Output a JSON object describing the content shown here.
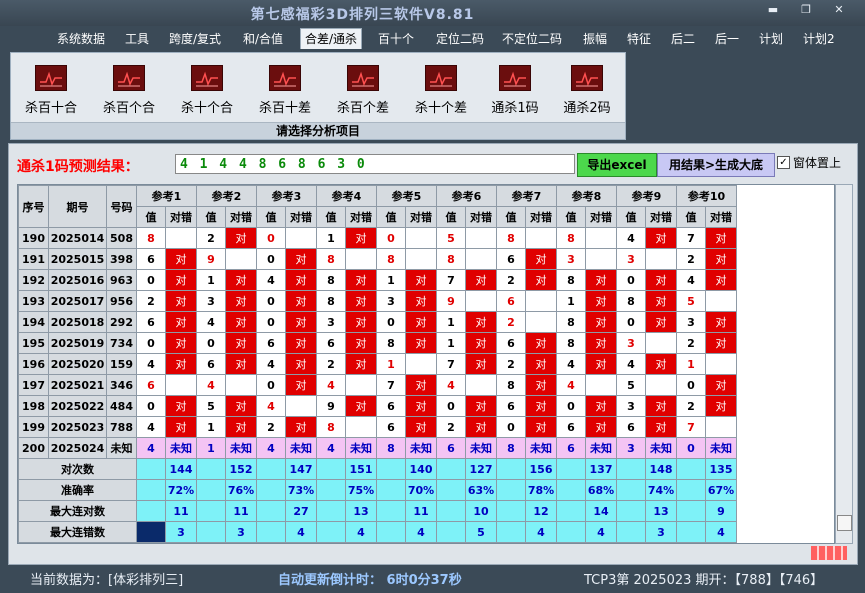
{
  "window": {
    "title": "第七感福彩3D排列三软件V8.81"
  },
  "menu": [
    "系统数据",
    "工具",
    "跨度/复式",
    "和/合值",
    "合差/通杀",
    "百十个",
    "定位二码",
    "不定位二码",
    "振幅",
    "特征",
    "后二",
    "后一",
    "计划",
    "计划2"
  ],
  "menu_active_index": 4,
  "ribbon": {
    "buttons": [
      "杀百十合",
      "杀百个合",
      "杀十个合",
      "杀百十差",
      "杀百个差",
      "杀十个差",
      "通杀1码",
      "通杀2码"
    ],
    "footer": "请选择分析项目"
  },
  "prediction": {
    "label": "通杀1码预测结果：",
    "value": "4 1 4 4 8 6 8 6 3 0",
    "excel_button": "导出excel",
    "generate_button": "用结果>生成大底",
    "topmost_label": "窗体置上",
    "topmost_checked": "✓"
  },
  "table": {
    "headers": {
      "seq": "序号",
      "period": "期号",
      "number": "号码",
      "refs": [
        "参考1",
        "参考2",
        "参考3",
        "参考4",
        "参考5",
        "参考6",
        "参考7",
        "参考8",
        "参考9",
        "参考10"
      ],
      "sub_value": "值",
      "sub_result": "对错"
    },
    "hit_text": "对",
    "rows": [
      {
        "seq": "190",
        "period": "2025014",
        "num": "508",
        "vals": [
          "8",
          "2",
          "0",
          "1",
          "0",
          "5",
          "8",
          "8",
          "4",
          "7"
        ],
        "hits": [
          0,
          1,
          0,
          1,
          0,
          0,
          0,
          0,
          1,
          1
        ],
        "red": [
          1,
          0,
          1,
          0,
          1,
          1,
          1,
          1,
          0,
          0
        ]
      },
      {
        "seq": "191",
        "period": "2025015",
        "num": "398",
        "vals": [
          "6",
          "9",
          "0",
          "8",
          "8",
          "8",
          "6",
          "3",
          "3",
          "2"
        ],
        "hits": [
          1,
          0,
          1,
          0,
          0,
          0,
          1,
          0,
          0,
          1
        ],
        "red": [
          0,
          1,
          0,
          1,
          1,
          1,
          0,
          1,
          1,
          0
        ]
      },
      {
        "seq": "192",
        "period": "2025016",
        "num": "963",
        "vals": [
          "0",
          "1",
          "4",
          "8",
          "1",
          "7",
          "2",
          "8",
          "0",
          "4"
        ],
        "hits": [
          1,
          1,
          1,
          1,
          1,
          1,
          1,
          1,
          1,
          1
        ],
        "red": [
          0,
          0,
          0,
          0,
          0,
          0,
          0,
          0,
          0,
          0
        ]
      },
      {
        "seq": "193",
        "period": "2025017",
        "num": "956",
        "vals": [
          "2",
          "3",
          "0",
          "8",
          "3",
          "9",
          "6",
          "1",
          "8",
          "5"
        ],
        "hits": [
          1,
          1,
          1,
          1,
          1,
          0,
          0,
          1,
          1,
          0
        ],
        "red": [
          0,
          0,
          0,
          0,
          0,
          1,
          1,
          0,
          0,
          1
        ]
      },
      {
        "seq": "194",
        "period": "2025018",
        "num": "292",
        "vals": [
          "6",
          "4",
          "0",
          "3",
          "0",
          "1",
          "2",
          "8",
          "0",
          "3"
        ],
        "hits": [
          1,
          1,
          1,
          1,
          1,
          1,
          0,
          1,
          1,
          1
        ],
        "red": [
          0,
          0,
          0,
          0,
          0,
          0,
          1,
          0,
          0,
          0
        ]
      },
      {
        "seq": "195",
        "period": "2025019",
        "num": "734",
        "vals": [
          "0",
          "0",
          "6",
          "6",
          "8",
          "1",
          "6",
          "8",
          "3",
          "2"
        ],
        "hits": [
          1,
          1,
          1,
          1,
          1,
          1,
          1,
          1,
          0,
          1
        ],
        "red": [
          0,
          0,
          0,
          0,
          0,
          0,
          0,
          0,
          1,
          0
        ]
      },
      {
        "seq": "196",
        "period": "2025020",
        "num": "159",
        "vals": [
          "4",
          "6",
          "4",
          "2",
          "1",
          "7",
          "2",
          "4",
          "4",
          "1"
        ],
        "hits": [
          1,
          1,
          1,
          1,
          0,
          1,
          1,
          1,
          1,
          0
        ],
        "red": [
          0,
          0,
          0,
          0,
          1,
          0,
          0,
          0,
          0,
          1
        ]
      },
      {
        "seq": "197",
        "period": "2025021",
        "num": "346",
        "vals": [
          "6",
          "4",
          "0",
          "4",
          "7",
          "4",
          "8",
          "4",
          "5",
          "0"
        ],
        "hits": [
          0,
          0,
          1,
          0,
          1,
          0,
          1,
          0,
          0,
          1
        ],
        "red": [
          1,
          1,
          0,
          1,
          0,
          1,
          0,
          1,
          0,
          0
        ]
      },
      {
        "seq": "198",
        "period": "2025022",
        "num": "484",
        "vals": [
          "0",
          "5",
          "4",
          "9",
          "6",
          "0",
          "6",
          "0",
          "3",
          "2"
        ],
        "hits": [
          1,
          1,
          0,
          1,
          1,
          1,
          1,
          1,
          1,
          1
        ],
        "red": [
          0,
          0,
          1,
          0,
          0,
          0,
          0,
          0,
          0,
          0
        ]
      },
      {
        "seq": "199",
        "period": "2025023",
        "num": "788",
        "vals": [
          "4",
          "1",
          "2",
          "8",
          "6",
          "2",
          "0",
          "6",
          "6",
          "7"
        ],
        "hits": [
          1,
          1,
          1,
          0,
          1,
          1,
          1,
          1,
          1,
          0
        ],
        "red": [
          0,
          0,
          0,
          1,
          0,
          0,
          0,
          0,
          0,
          1
        ]
      }
    ],
    "unknown_row": {
      "seq": "200",
      "period": "2025024",
      "num": "未知",
      "vals": [
        "4",
        "1",
        "4",
        "4",
        "8",
        "6",
        "8",
        "6",
        "3",
        "0"
      ],
      "result": "未知"
    },
    "stats": [
      {
        "label": "对次数",
        "values": [
          "144",
          "152",
          "147",
          "151",
          "140",
          "127",
          "156",
          "137",
          "148",
          "135"
        ]
      },
      {
        "label": "准确率",
        "values": [
          "72%",
          "76%",
          "73%",
          "75%",
          "70%",
          "63%",
          "78%",
          "68%",
          "74%",
          "67%"
        ]
      },
      {
        "label": "最大连对数",
        "values": [
          "11",
          "11",
          "27",
          "13",
          "11",
          "10",
          "12",
          "14",
          "13",
          "9"
        ]
      },
      {
        "label": "最大连错数",
        "values": [
          "3",
          "3",
          "4",
          "4",
          "4",
          "5",
          "4",
          "4",
          "3",
          "4"
        ]
      }
    ]
  },
  "status": {
    "current_data": "当前数据为：[体彩排列三]",
    "countdown": "自动更新倒计时：  6时0分37秒",
    "latest": "TCP3第 2025023 期开：【788】【746】"
  },
  "colors": {
    "hit": "#e00000",
    "stat_bg": "#7ef2f8",
    "unknown_bg": "#f4c4f4",
    "excel_btn": "#4cd84c",
    "gen_btn": "#c8c8f4"
  }
}
